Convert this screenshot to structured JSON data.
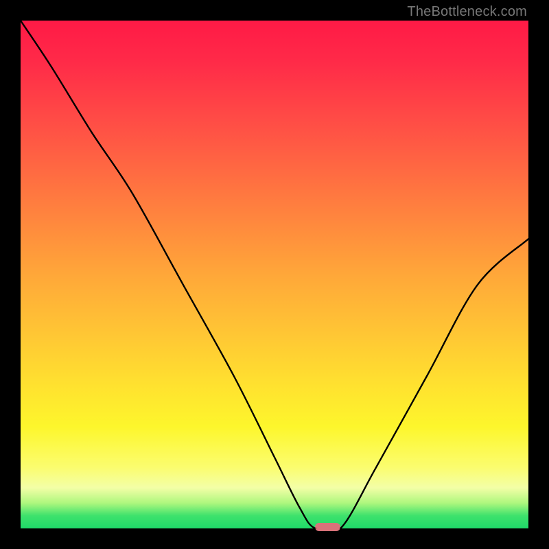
{
  "attribution": "TheBottleneck.com",
  "colors": {
    "gradient_top": "#ff1a46",
    "gradient_mid": "#ffe22f",
    "gradient_bottom": "#1fd969",
    "curve": "#000000",
    "marker": "#d9727a",
    "frame": "#000000"
  },
  "chart_data": {
    "type": "line",
    "title": "",
    "xlabel": "",
    "ylabel": "",
    "xlim": [
      0,
      100
    ],
    "ylim": [
      0,
      100
    ],
    "grid": false,
    "legend": false,
    "marker": {
      "x_start": 58,
      "x_end": 63,
      "y": 0
    },
    "series": [
      {
        "name": "bottleneck-curve",
        "x": [
          0,
          6,
          14,
          22,
          32,
          42,
          50,
          55,
          58,
          63,
          70,
          80,
          90,
          100
        ],
        "y": [
          100,
          91,
          78,
          66,
          48,
          30,
          14,
          4,
          0,
          0,
          12,
          30,
          48,
          57
        ]
      }
    ],
    "note": "y=100 is top (worst / red), y=0 is bottom (best / green). Curve descends from top-left, has knee near x≈14, reaches 0 around x≈58–63 (marker), then rises to ~57 at right edge."
  }
}
